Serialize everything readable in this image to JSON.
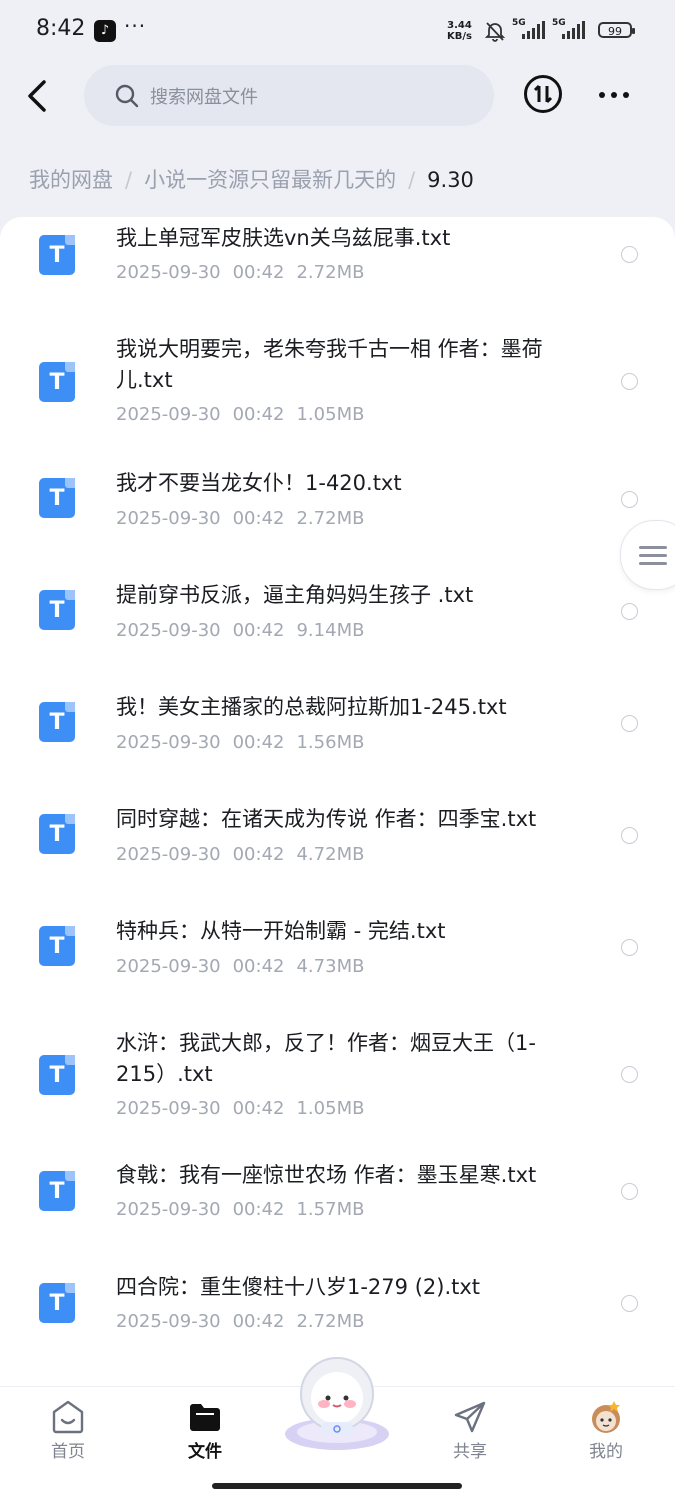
{
  "status_bar": {
    "time": "8:42",
    "dots": "···",
    "net_speed_value": "3.44",
    "net_speed_unit": "KB/s",
    "signal1_label": "5G",
    "signal2_label": "5G",
    "battery": "99"
  },
  "header": {
    "search_placeholder": "搜索网盘文件"
  },
  "breadcrumb": {
    "root": "我的网盘",
    "folder": "小说一资源只留最新几天的",
    "current": "9.30",
    "separator": "/"
  },
  "files": [
    {
      "name": "我上单冠军皮肤选vn关乌兹屁事.txt",
      "date": "2025-09-30",
      "time": "00:42",
      "size": "2.72MB"
    },
    {
      "name": "我说大明要完，老朱夸我千古一相 作者：墨荷儿.txt",
      "date": "2025-09-30",
      "time": "00:42",
      "size": "1.05MB"
    },
    {
      "name": "我才不要当龙女仆！1-420.txt",
      "date": "2025-09-30",
      "time": "00:42",
      "size": "2.72MB"
    },
    {
      "name": "提前穿书反派，逼主角妈妈生孩子 .txt",
      "date": "2025-09-30",
      "time": "00:42",
      "size": "9.14MB"
    },
    {
      "name": "我！美女主播家的总裁阿拉斯加1-245.txt",
      "date": "2025-09-30",
      "time": "00:42",
      "size": "1.56MB"
    },
    {
      "name": "同时穿越：在诸天成为传说 作者：四季宝.txt",
      "date": "2025-09-30",
      "time": "00:42",
      "size": "4.72MB"
    },
    {
      "name": "特种兵：从特一开始制霸 - 完结.txt",
      "date": "2025-09-30",
      "time": "00:42",
      "size": "4.73MB"
    },
    {
      "name": "水浒：我武大郎，反了！作者：烟豆大王（1-215）.txt",
      "date": "2025-09-30",
      "time": "00:42",
      "size": "1.05MB"
    },
    {
      "name": "食戟：我有一座惊世农场 作者：墨玉星寒.txt",
      "date": "2025-09-30",
      "time": "00:42",
      "size": "1.57MB"
    },
    {
      "name": "四合院：重生傻柱十八岁1-279 (2).txt",
      "date": "2025-09-30",
      "time": "00:42",
      "size": "2.72MB"
    }
  ],
  "file_icon_letter": "T",
  "bottom_nav": {
    "home": "首页",
    "files": "文件",
    "share": "共享",
    "mine": "我的"
  },
  "colors": {
    "accent": "#3d8ef5",
    "background": "#eef0f6"
  }
}
